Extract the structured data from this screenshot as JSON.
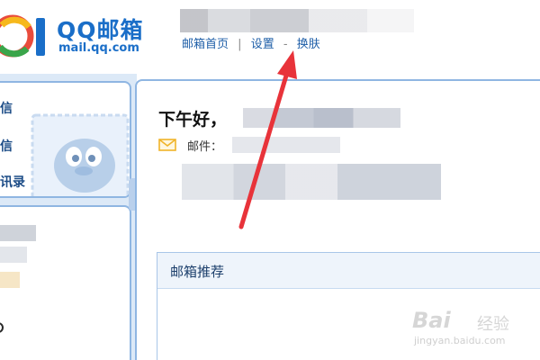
{
  "logo": {
    "title": "QQ邮箱",
    "subtitle": "mail.qq.com"
  },
  "header": {
    "links": [
      {
        "label": "邮箱首页"
      },
      {
        "label": "设置"
      },
      {
        "label": "换肤"
      }
    ],
    "separators": [
      "|",
      "-"
    ]
  },
  "sidebar": {
    "folders": [
      {
        "label": "信"
      },
      {
        "label": "信"
      },
      {
        "label": "讯录"
      }
    ]
  },
  "main": {
    "greeting": "下午好，",
    "mail_label": "邮件：",
    "recommend_title": "邮箱推荐"
  },
  "watermark": {
    "brand": "Bai",
    "jingyan": "经验",
    "url": "jingyan.baidu.com"
  },
  "colors": {
    "brand_blue": "#1a6ec8",
    "link_blue": "#1f5fa8",
    "panel_border": "#8fb6e2",
    "arrow_red": "#e8333a",
    "envelope_yellow": "#f0b429"
  }
}
